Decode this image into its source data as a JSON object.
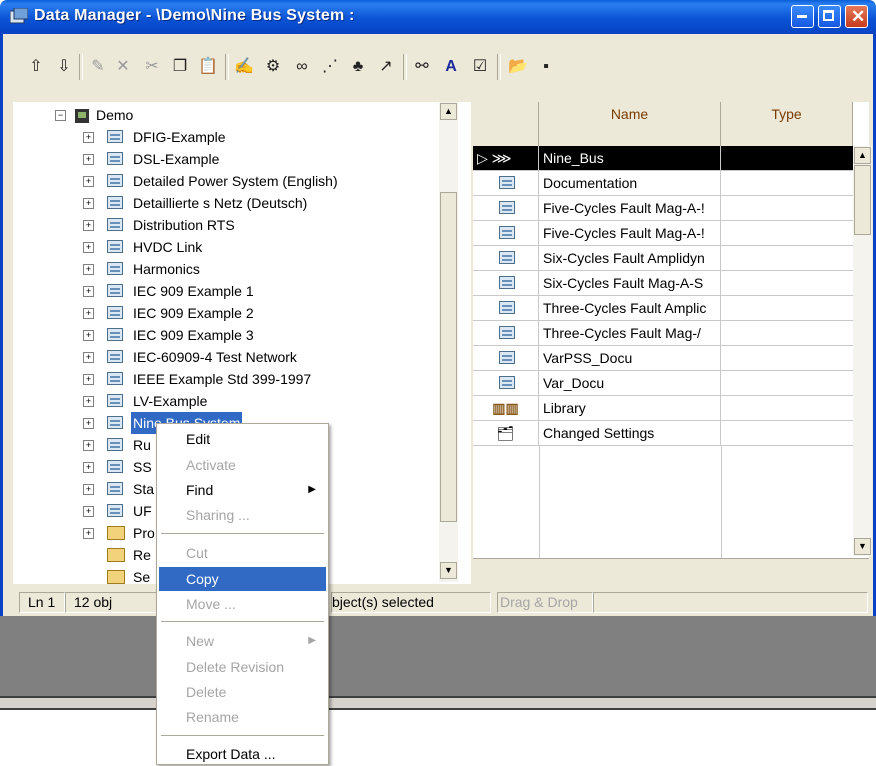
{
  "window": {
    "title": "Data Manager - \\Demo\\Nine Bus System :",
    "buttons": [
      "minimize",
      "maximize",
      "close"
    ]
  },
  "toolbar": {
    "icons": [
      "folder-up-icon",
      "folder-down-icon",
      "new-object-icon",
      "delete-icon",
      "cut-icon",
      "copy-icon",
      "paste-icon",
      "edit-icon",
      "detail-icon",
      "binoculars-view-icon",
      "graph-icon",
      "network-icon",
      "chart-icon",
      "find-icon",
      "font-icon",
      "report-icon",
      "open-icon",
      "save-icon"
    ]
  },
  "tree": {
    "root": "Demo",
    "items": [
      {
        "label": "DFIG-Example",
        "icon": "project-icon"
      },
      {
        "label": "DSL-Example",
        "icon": "project-icon"
      },
      {
        "label": "Detailed Power System (English)",
        "icon": "project-icon"
      },
      {
        "label": "Detaillierte s Netz (Deutsch)",
        "icon": "project-icon"
      },
      {
        "label": "Distribution RTS",
        "icon": "project-icon"
      },
      {
        "label": "HVDC Link",
        "icon": "project-icon"
      },
      {
        "label": "Harmonics",
        "icon": "project-icon"
      },
      {
        "label": "IEC 909 Example 1",
        "icon": "project-icon"
      },
      {
        "label": "IEC 909 Example 2",
        "icon": "project-icon"
      },
      {
        "label": "IEC 909 Example 3",
        "icon": "project-icon"
      },
      {
        "label": "IEC-60909-4 Test Network",
        "icon": "project-icon"
      },
      {
        "label": "IEEE Example Std 399-1997",
        "icon": "project-icon"
      },
      {
        "label": "LV-Example",
        "icon": "project-icon"
      },
      {
        "label": "Nine Bus System",
        "icon": "project-icon"
      },
      {
        "label": "Ru",
        "icon": "project-icon"
      },
      {
        "label": "SS",
        "icon": "project-icon"
      },
      {
        "label": "Sta",
        "icon": "project-icon"
      },
      {
        "label": "UF",
        "icon": "project-icon"
      },
      {
        "label": "Pro",
        "icon": "folder-icon"
      },
      {
        "label": "Re",
        "icon": "folder-icon"
      },
      {
        "label": "Se",
        "icon": "folder-icon"
      }
    ]
  },
  "grid": {
    "columns": [
      "Name",
      "Type"
    ],
    "rows": [
      {
        "name": "Nine_Bus",
        "icon": "grid-icon",
        "selected": true
      },
      {
        "name": "Documentation",
        "icon": "page-icon"
      },
      {
        "name": "Five-Cycles Fault Mag-A-!",
        "icon": "page-icon"
      },
      {
        "name": "Five-Cycles Fault Mag-A-!",
        "icon": "page-icon"
      },
      {
        "name": "Six-Cycles Fault Amplidyn",
        "icon": "page-icon"
      },
      {
        "name": "Six-Cycles Fault Mag-A-S",
        "icon": "page-icon"
      },
      {
        "name": "Three-Cycles Fault Amplic",
        "icon": "page-icon"
      },
      {
        "name": "Three-Cycles Fault Mag-/",
        "icon": "page-icon"
      },
      {
        "name": "VarPSS_Docu",
        "icon": "page-icon"
      },
      {
        "name": "Var_Docu",
        "icon": "page-icon"
      },
      {
        "name": "Library",
        "icon": "library-icon"
      },
      {
        "name": "Changed Settings",
        "icon": "settings-icon"
      }
    ]
  },
  "status": {
    "line": "Ln 1",
    "objects": "12 obj",
    "selected": "bject(s) selected",
    "dragdrop": "Drag & Drop"
  },
  "context_menu": {
    "items": [
      {
        "label": "Edit",
        "disabled": false
      },
      {
        "label": "Activate",
        "disabled": true
      },
      {
        "label": "Find",
        "disabled": false,
        "submenu": true
      },
      {
        "label": "Sharing ...",
        "disabled": true
      },
      {
        "label": "Cut",
        "disabled": true
      },
      {
        "label": "Copy",
        "disabled": false,
        "highlighted": true
      },
      {
        "label": "Move ...",
        "disabled": true
      },
      {
        "label": "New",
        "disabled": true,
        "submenu": true
      },
      {
        "label": "Delete Revision",
        "disabled": true
      },
      {
        "label": "Delete",
        "disabled": true
      },
      {
        "label": "Rename",
        "disabled": true
      },
      {
        "label": "Export Data ...",
        "disabled": false
      }
    ]
  },
  "colors": {
    "titlebar": "#0b53d6",
    "selection": "#316ac5",
    "header_text": "#7a3a00"
  }
}
